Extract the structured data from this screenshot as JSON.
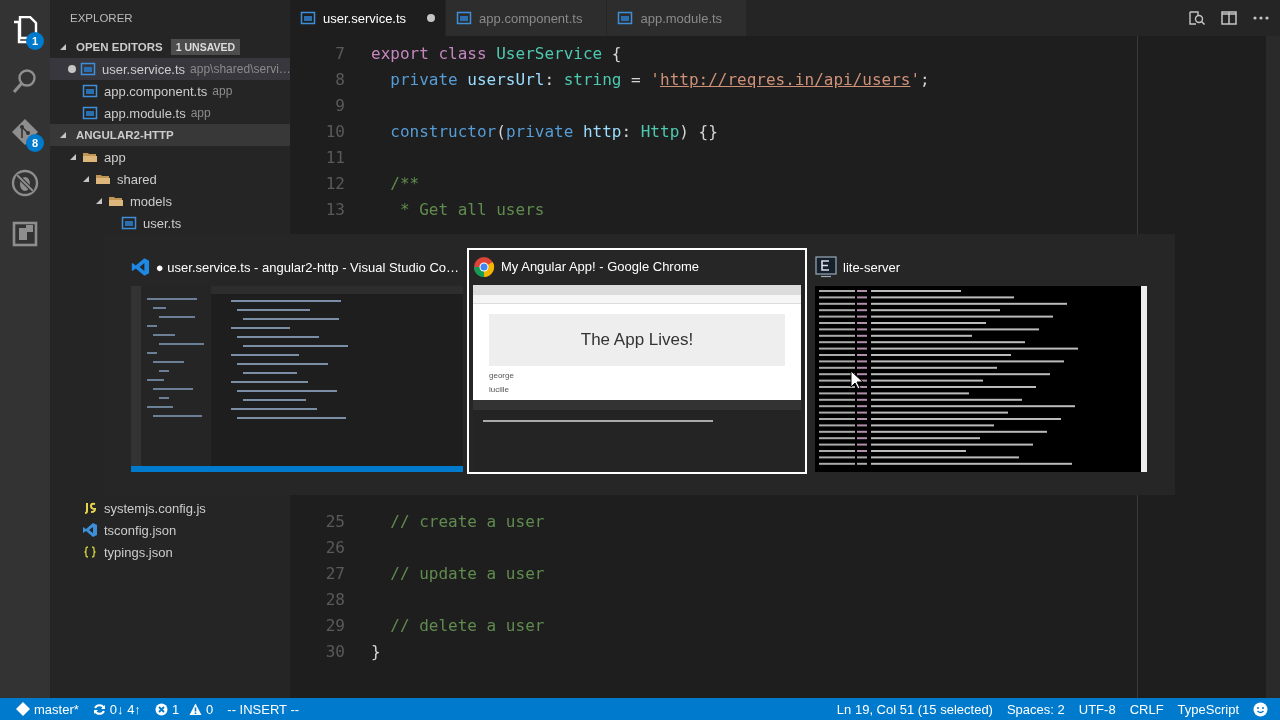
{
  "activity_bar": {
    "items": [
      {
        "kind": "files",
        "selected": true,
        "badge": "1"
      },
      {
        "kind": "search",
        "selected": false
      },
      {
        "kind": "git",
        "selected": false,
        "badge": "8"
      },
      {
        "kind": "debug",
        "selected": false
      },
      {
        "kind": "extensions",
        "selected": false
      }
    ]
  },
  "sidebar": {
    "title": "EXPLORER",
    "open_editors": {
      "title": "OPEN EDITORS",
      "badge": "1 UNSAVED",
      "expanded": true,
      "items": [
        {
          "name": "user.service.ts",
          "path": "app\\shared\\servi…",
          "kind": "ts",
          "modified": true,
          "selected": true
        },
        {
          "name": "app.component.ts",
          "path": "app",
          "kind": "ts",
          "modified": false,
          "selected": false
        },
        {
          "name": "app.module.ts",
          "path": "app",
          "kind": "ts",
          "modified": false,
          "selected": false
        }
      ]
    },
    "project": {
      "title": "ANGULAR2-HTTP",
      "expanded": true,
      "tree": [
        {
          "name": "app",
          "kind": "folder",
          "expanded": true,
          "children": [
            {
              "name": "shared",
              "kind": "folder",
              "expanded": true,
              "children": [
                {
                  "name": "models",
                  "kind": "folder",
                  "expanded": true,
                  "children": [
                    {
                      "name": "user.ts",
                      "kind": "ts"
                    }
                  ]
                }
              ]
            }
          ]
        }
      ],
      "tree_below": [
        {
          "name": "systemjs.config.js",
          "kind": "js"
        },
        {
          "name": "tsconfig.json",
          "kind": "tsconfig"
        },
        {
          "name": "typings.json",
          "kind": "json"
        }
      ]
    }
  },
  "tabs": [
    {
      "label": "user.service.ts",
      "selected": true,
      "modified": true
    },
    {
      "label": "app.component.ts",
      "selected": false,
      "modified": false
    },
    {
      "label": "app.module.ts",
      "selected": false,
      "modified": false
    }
  ],
  "editor": {
    "lines_top": [
      {
        "number": "7",
        "tokens": [
          {
            "kind": "keyword",
            "text": "export "
          },
          {
            "kind": "keyword",
            "text": "class "
          },
          {
            "kind": "type",
            "text": "UserService"
          },
          {
            "kind": "plain",
            "text": " {"
          }
        ]
      },
      {
        "number": "8",
        "tokens": [
          {
            "kind": "storage",
            "text": "  private "
          },
          {
            "kind": "variable",
            "text": "usersUrl"
          },
          {
            "kind": "plain",
            "text": ": "
          },
          {
            "kind": "type",
            "text": "string"
          },
          {
            "kind": "plain",
            "text": " = "
          },
          {
            "kind": "string",
            "text": "'"
          },
          {
            "kind": "link",
            "text": "http://reqres.in/api/users"
          },
          {
            "kind": "string",
            "text": "'"
          },
          {
            "kind": "plain",
            "text": ";"
          }
        ]
      },
      {
        "number": "9"
      },
      {
        "number": "10",
        "tokens": [
          {
            "kind": "storage",
            "text": "  constructor"
          },
          {
            "kind": "plain",
            "text": "("
          },
          {
            "kind": "storage",
            "text": "private "
          },
          {
            "kind": "variable",
            "text": "http"
          },
          {
            "kind": "plain",
            "text": ": "
          },
          {
            "kind": "type",
            "text": "Http"
          },
          {
            "kind": "plain",
            "text": ") {}"
          }
        ]
      },
      {
        "number": "11"
      },
      {
        "number": "12",
        "tokens": [
          {
            "kind": "comment",
            "text": "  /**"
          }
        ]
      },
      {
        "number": "13",
        "tokens": [
          {
            "kind": "comment",
            "text": "   * Get all users"
          }
        ]
      }
    ],
    "lines_bottom": [
      {
        "number": "25",
        "tokens": [
          {
            "kind": "comment",
            "text": "  // create a user"
          }
        ]
      },
      {
        "number": "26"
      },
      {
        "number": "27",
        "tokens": [
          {
            "kind": "comment",
            "text": "  // update a user"
          }
        ]
      },
      {
        "number": "28"
      },
      {
        "number": "29",
        "tokens": [
          {
            "kind": "comment",
            "text": "  // delete a user"
          }
        ]
      },
      {
        "number": "30",
        "tokens": [
          {
            "kind": "plain",
            "text": "}"
          }
        ]
      }
    ]
  },
  "switcher": {
    "windows": [
      {
        "kind": "vscode",
        "title": "● user.service.ts - angular2-http - Visual Studio Co…",
        "selected": false
      },
      {
        "kind": "chrome",
        "title": "My Angular App! - Google Chrome",
        "selected": true,
        "page": {
          "heading": "The App Lives!",
          "items": [
            "george",
            "lucille"
          ]
        }
      },
      {
        "kind": "terminal",
        "title": "lite-server",
        "selected": false
      }
    ]
  },
  "status_bar": {
    "branch": "master*",
    "sync": "0↓ 4↑",
    "errors": "1",
    "warnings": "0",
    "mode": "-- INSERT --",
    "position": "Ln 19, Col 51 (15 selected)",
    "indent": "Spaces: 2",
    "encoding": "UTF-8",
    "eol": "CRLF",
    "language": "TypeScript"
  }
}
